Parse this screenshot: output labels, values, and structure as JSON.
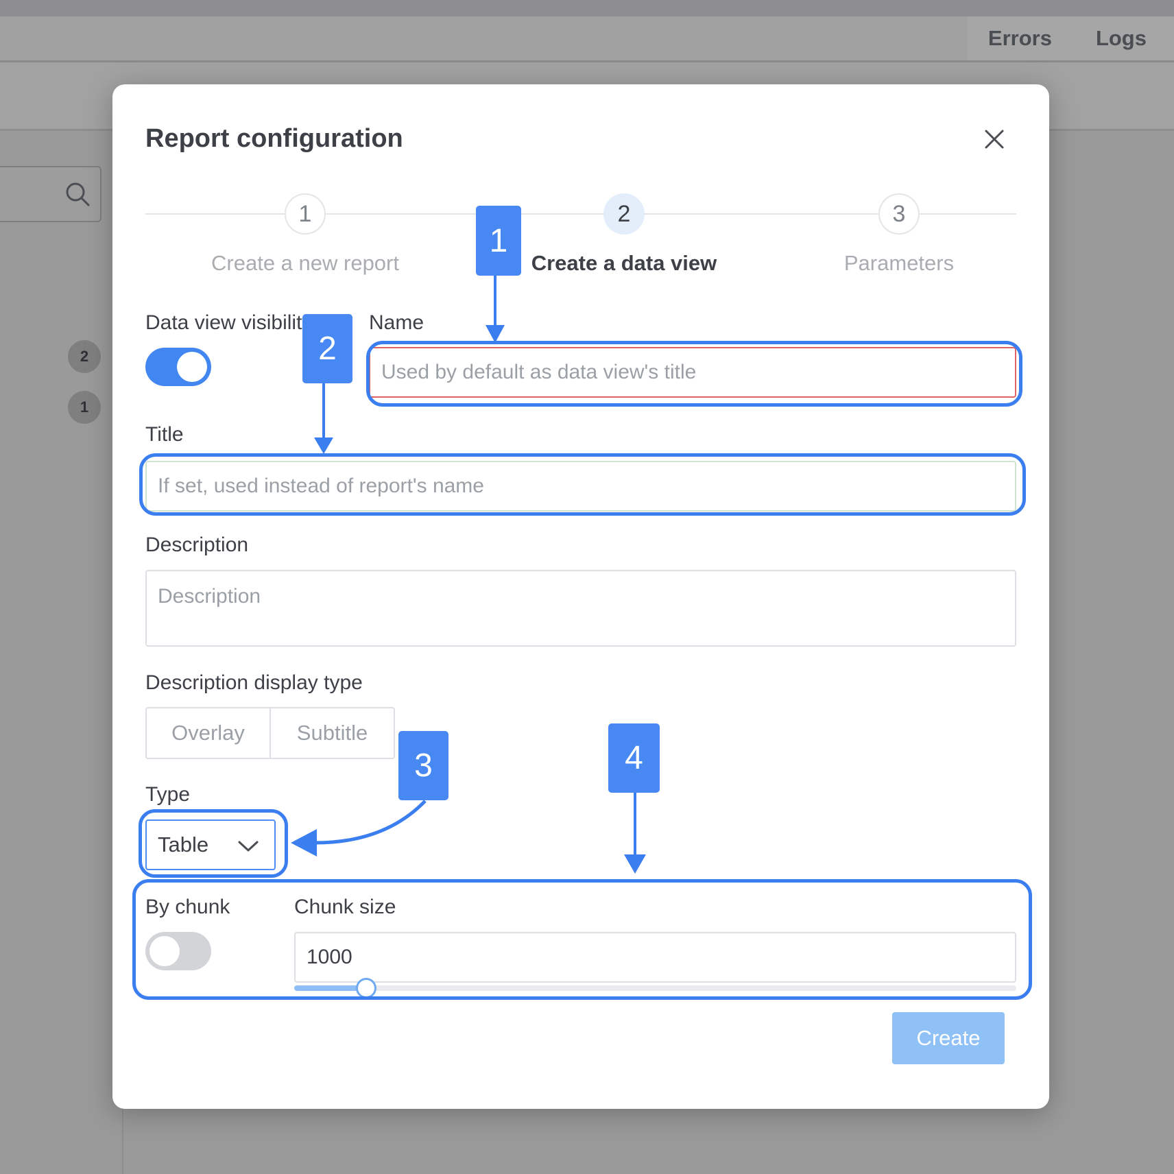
{
  "background": {
    "header_links": [
      "Errors",
      "Logs"
    ],
    "badges": [
      "2",
      "1"
    ]
  },
  "modal": {
    "title": "Report configuration",
    "steps": [
      {
        "number": "1",
        "label": "Create a new report",
        "state": "done"
      },
      {
        "number": "2",
        "label": "Create a data view",
        "state": "active"
      },
      {
        "number": "3",
        "label": "Parameters",
        "state": "pending"
      }
    ],
    "visibility": {
      "label": "Data view visibility",
      "on": true
    },
    "name": {
      "label": "Name",
      "placeholder": "Used by default as data view's title"
    },
    "title_field": {
      "label": "Title",
      "placeholder": "If set, used instead of report's name"
    },
    "description": {
      "label": "Description",
      "placeholder": "Description"
    },
    "display_type": {
      "label": "Description display type",
      "options": [
        "Overlay",
        "Subtitle"
      ]
    },
    "type": {
      "label": "Type",
      "value": "Table"
    },
    "by_chunk": {
      "label": "By chunk",
      "on": false
    },
    "chunk_size": {
      "label": "Chunk size",
      "value": "1000",
      "slider_fraction": 0.1
    },
    "create_label": "Create"
  },
  "annotations": [
    "1",
    "2",
    "3",
    "4"
  ],
  "colors": {
    "accent": "#4286f2",
    "annotation": "#3b7ef0",
    "create_button": "#8fc0f6"
  }
}
